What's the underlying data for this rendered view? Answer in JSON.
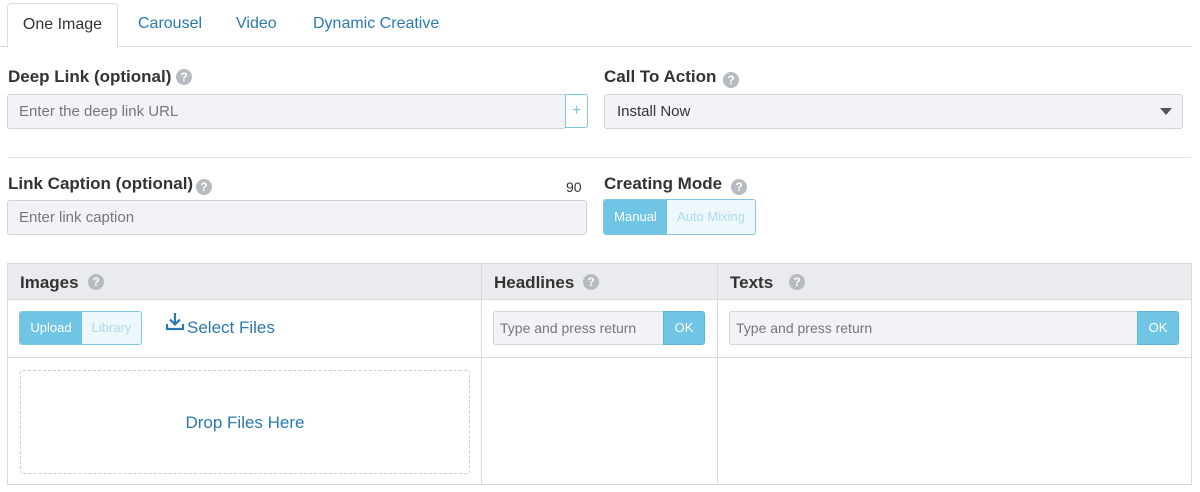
{
  "tabs": [
    {
      "label": "One Image",
      "active": true
    },
    {
      "label": "Carousel",
      "active": false
    },
    {
      "label": "Video",
      "active": false
    },
    {
      "label": "Dynamic Creative",
      "active": false
    }
  ],
  "deep_link": {
    "label": "Deep Link (optional)",
    "placeholder": "Enter the deep link URL",
    "add_glyph": "+"
  },
  "call_to_action": {
    "label": "Call To Action",
    "selected": "Install Now"
  },
  "link_caption": {
    "label": "Link Caption (optional)",
    "placeholder": "Enter link caption",
    "char_limit": "90"
  },
  "creating_mode": {
    "label": "Creating Mode",
    "options": [
      "Manual",
      "Auto Mixing"
    ],
    "selected": "Manual"
  },
  "help_glyph": "?",
  "images": {
    "title": "Images",
    "source_options": [
      "Upload",
      "Library"
    ],
    "selected_source": "Upload",
    "select_files_label": "Select Files",
    "drop_label": "Drop Files Here"
  },
  "headlines": {
    "title": "Headlines",
    "placeholder": "Type and press return",
    "ok_label": "OK"
  },
  "texts": {
    "title": "Texts",
    "placeholder": "Type and press return",
    "ok_label": "OK"
  },
  "colors": {
    "accent": "#70c4e4",
    "link": "#2a7ab0",
    "header_bg": "#e9ebee"
  }
}
